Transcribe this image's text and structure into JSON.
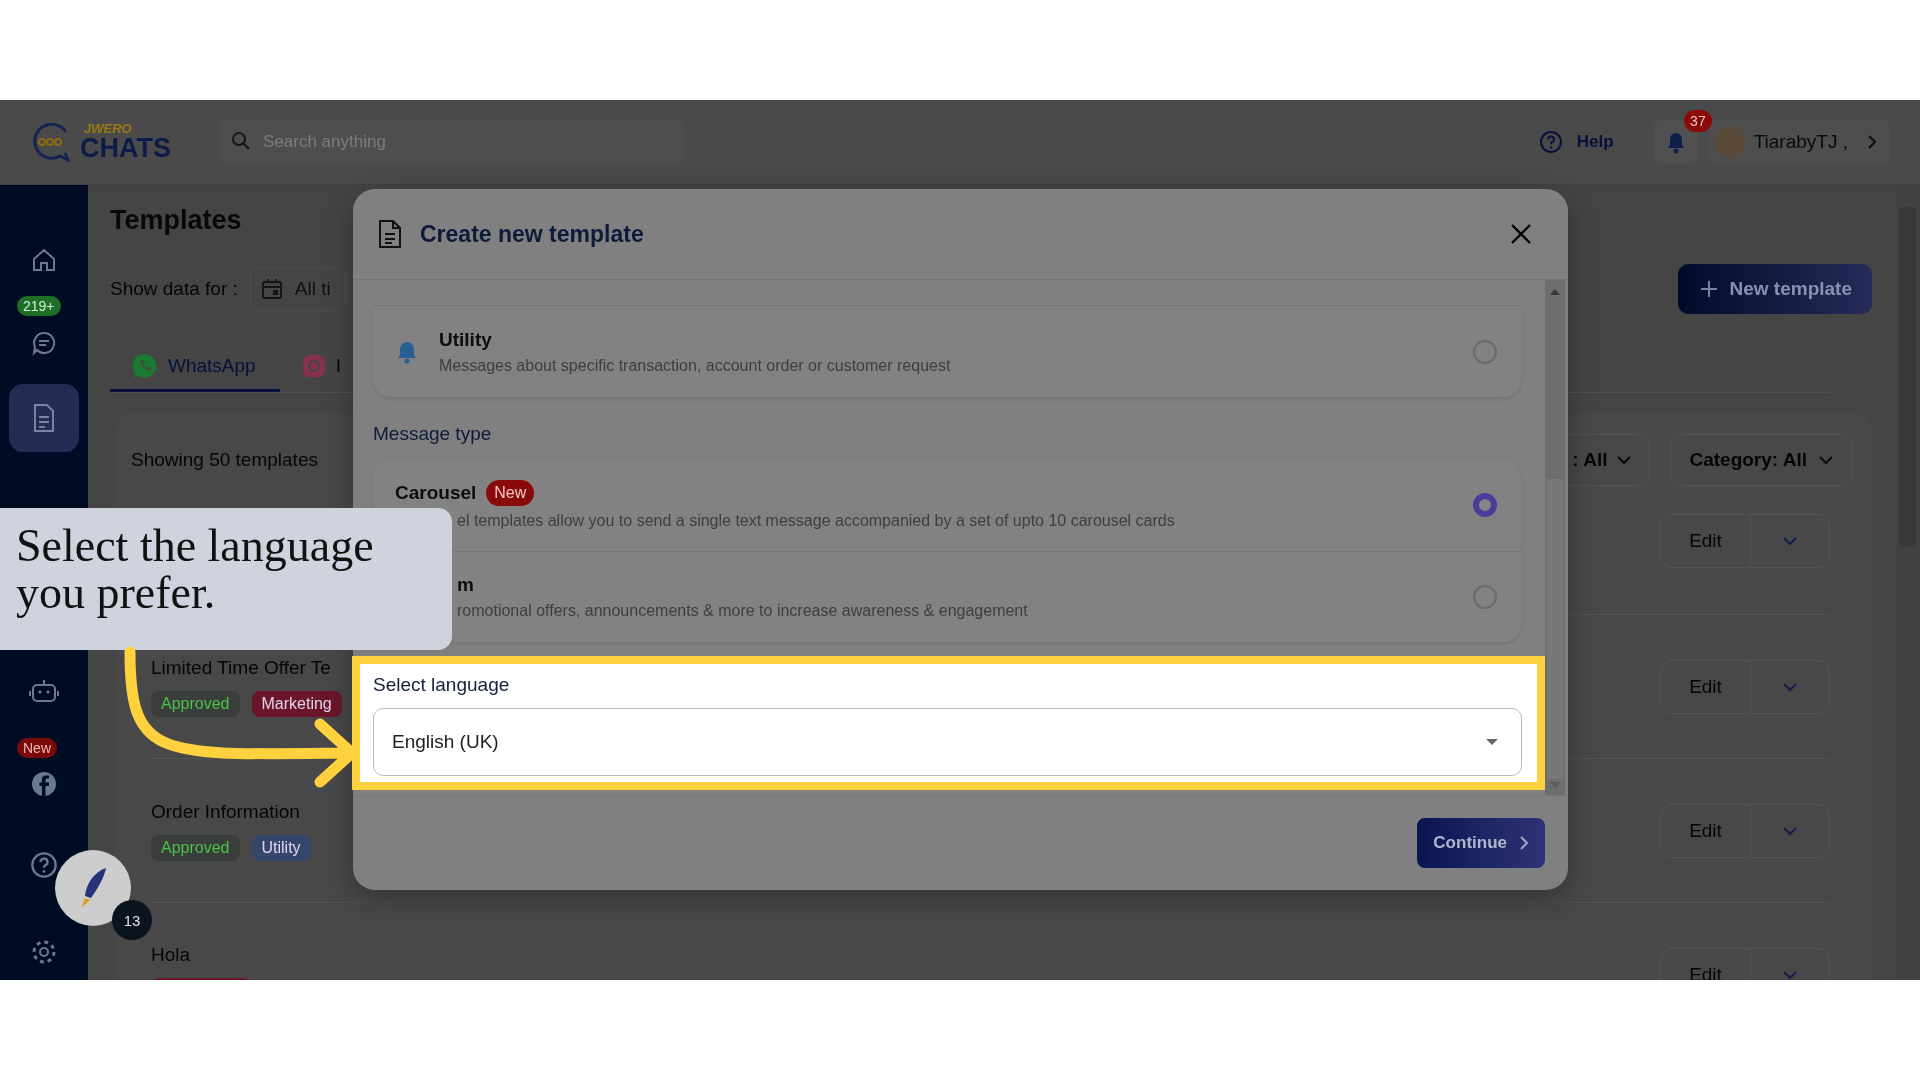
{
  "header": {
    "logo_top": "JWERO",
    "logo_bottom": "CHATS",
    "search": {
      "placeholder": "Search anything"
    },
    "help": "Help",
    "notifications": "37",
    "user": "TiarabyTJ ,"
  },
  "sidebar": {
    "top_items": [
      {
        "kind": "home",
        "selected": false
      },
      {
        "kind": "chats",
        "badge": "219+",
        "selected": false
      },
      {
        "kind": "templates",
        "selected": true
      }
    ],
    "bottom_items": [
      {
        "kind": "bot",
        "selected": false
      },
      {
        "kind": "facebook",
        "badge": "New",
        "selected": false
      },
      {
        "kind": "help",
        "selected": false
      },
      {
        "kind": "settings",
        "selected": false
      }
    ]
  },
  "launcher": {
    "count": "13"
  },
  "page": {
    "title": "Templates",
    "show_data_label": "Show data for :",
    "date_range": "All ti",
    "new_template": "New template",
    "tabs": [
      {
        "kind": "whatsapp",
        "label": "WhatsApp",
        "selected": true
      },
      {
        "kind": "instagram",
        "label": "I",
        "selected": false
      }
    ],
    "count_text": "Showing 50 templates",
    "filters": [
      {
        "label": ": All"
      },
      {
        "label": "Category: All"
      }
    ],
    "templates": [
      {
        "action": "Edit"
      },
      {
        "name": "Limited Time Offer Te",
        "status": "Approved",
        "category": {
          "label": "Marketing",
          "color": "#6a1628"
        },
        "action": "Edit"
      },
      {
        "name": "Order Information",
        "status": "Approved",
        "category": {
          "label": "Utility",
          "color": "#34466a"
        },
        "action": "Edit"
      },
      {
        "name": "Hola",
        "category": {
          "color": "#6a1628"
        },
        "action": "Edit"
      }
    ]
  },
  "modal": {
    "title": "Create new template",
    "categories": [
      {
        "name": "Utility",
        "description": "Messages about specific transaction, account order or customer request",
        "selected": false
      }
    ],
    "message_type_label": "Message type",
    "message_types": [
      {
        "name": {
          "text": "Carousel",
          "covered": false
        },
        "badge": "New",
        "description": {
          "text": "el templates allow you to send a single text message accompanied by a set of upto 10 carousel cards",
          "covered": true
        },
        "selected": true
      },
      {
        "name": {
          "text": "m",
          "covered": true
        },
        "description": {
          "text": "romotional offers, announcements & more to increase awareness & engagement",
          "covered": true
        },
        "selected": false
      }
    ],
    "language_label": "Select language",
    "language": "English (UK)",
    "continue": "Continue"
  },
  "tooltip": {
    "text": "Select the language you prefer."
  }
}
